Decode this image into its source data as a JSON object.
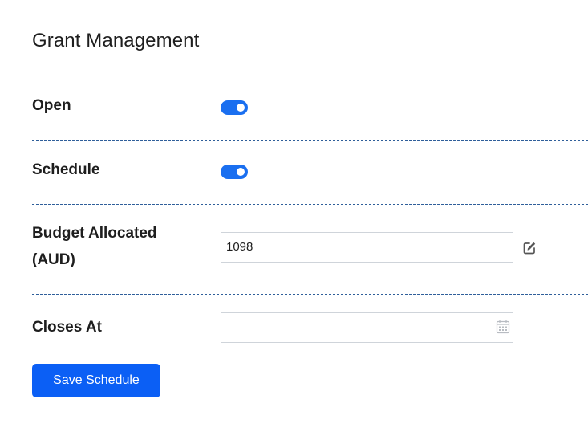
{
  "page": {
    "title": "Grant Management"
  },
  "fields": {
    "open": {
      "label": "Open",
      "enabled": true
    },
    "schedule": {
      "label": "Schedule",
      "enabled": true
    },
    "budget": {
      "label_line1": "Budget Allocated",
      "label_line2": "(AUD)",
      "value": "1098",
      "edit_icon": "edit-icon"
    },
    "closes_at": {
      "label": "Closes At",
      "value": "",
      "picker_icon": "calendar-icon"
    }
  },
  "actions": {
    "save_label": "Save Schedule"
  },
  "colors": {
    "accent": "#1a6ff0",
    "button": "#0b5ff5",
    "divider": "#2f5f9a"
  }
}
